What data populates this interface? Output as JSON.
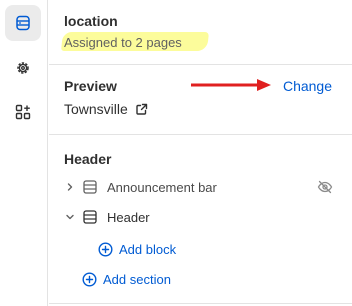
{
  "sidebar": {
    "items": [
      {
        "icon": "sections-icon",
        "active": true
      },
      {
        "icon": "gear-icon",
        "active": false
      },
      {
        "icon": "apps-add-icon",
        "active": false
      }
    ]
  },
  "template": {
    "title": "location",
    "assignment": "Assigned to 2 pages"
  },
  "preview": {
    "label": "Preview",
    "change_label": "Change",
    "store_name": "Townsville"
  },
  "header_group": {
    "label": "Header",
    "sections": [
      {
        "label": "Announcement bar",
        "expanded": false,
        "hidden": true
      },
      {
        "label": "Header",
        "expanded": true,
        "hidden": false
      }
    ],
    "add_block_label": "Add block",
    "add_section_label": "Add section"
  },
  "colors": {
    "link": "#005bd3",
    "annotation_arrow": "#e02020",
    "highlight": "#fbfb8a"
  }
}
